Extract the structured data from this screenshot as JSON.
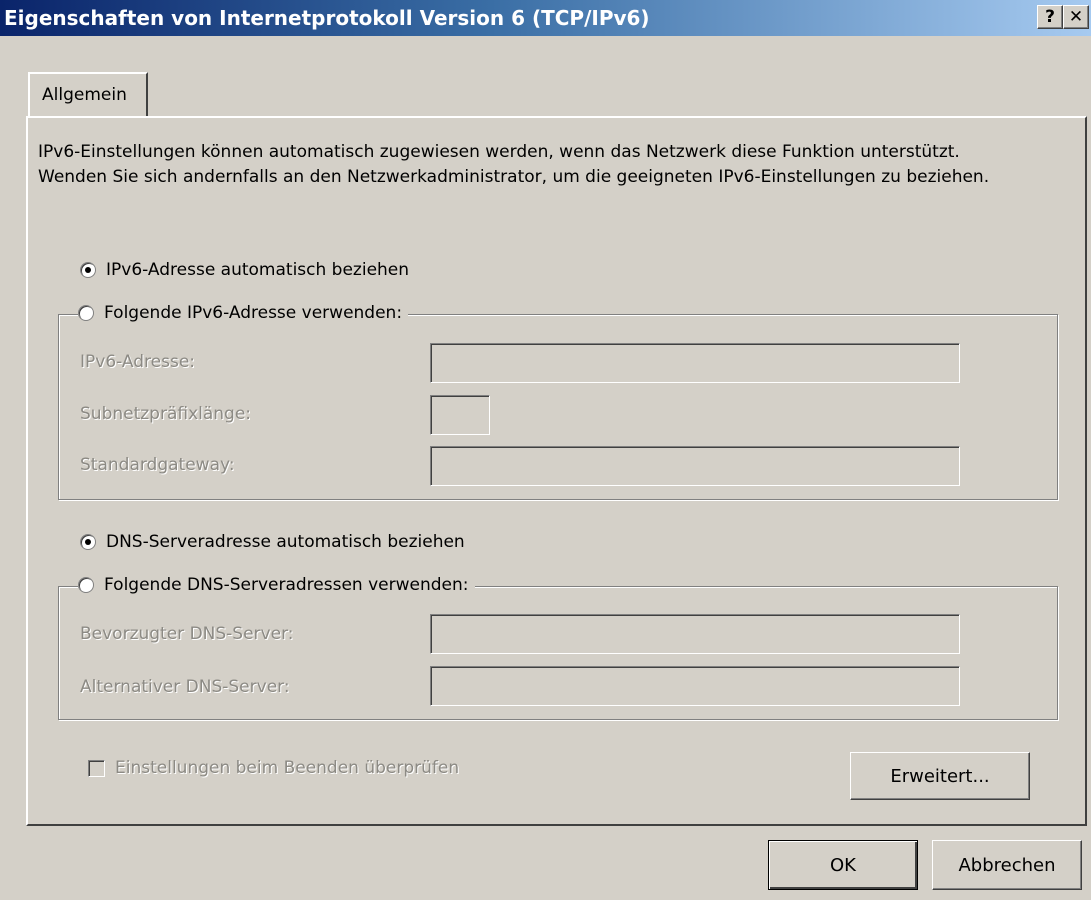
{
  "window": {
    "title": "Eigenschaften von Internetprotokoll Version 6 (TCP/IPv6)",
    "help_label": "?",
    "close_label": "✕"
  },
  "tabs": [
    {
      "label": "Allgemein"
    }
  ],
  "intro_text": "IPv6-Einstellungen können automatisch zugewiesen werden, wenn das Netzwerk diese Funktion unterstützt. Wenden Sie sich andernfalls an den Netzwerkadministrator, um die geeigneten IPv6-Einstellungen zu beziehen.",
  "address": {
    "auto_label": "IPv6-Adresse automatisch beziehen",
    "auto_checked": true,
    "manual_label": "Folgende IPv6-Adresse verwenden:",
    "manual_checked": false,
    "fields": [
      {
        "label": "IPv6-Adresse:",
        "value": ""
      },
      {
        "label": "Subnetzpräfixlänge:",
        "value": ""
      },
      {
        "label": "Standardgateway:",
        "value": ""
      }
    ]
  },
  "dns": {
    "auto_label": "DNS-Serveradresse automatisch beziehen",
    "auto_checked": true,
    "manual_label": "Folgende DNS-Serveradressen verwenden:",
    "manual_checked": false,
    "fields": [
      {
        "label": "Bevorzugter DNS-Server:",
        "value": ""
      },
      {
        "label": "Alternativer DNS-Server:",
        "value": ""
      }
    ]
  },
  "validate_checkbox": {
    "label": "Einstellungen beim Beenden überprüfen",
    "checked": false,
    "enabled": false
  },
  "buttons": {
    "advanced": "Erweitert...",
    "ok": "OK",
    "cancel": "Abbrechen"
  }
}
